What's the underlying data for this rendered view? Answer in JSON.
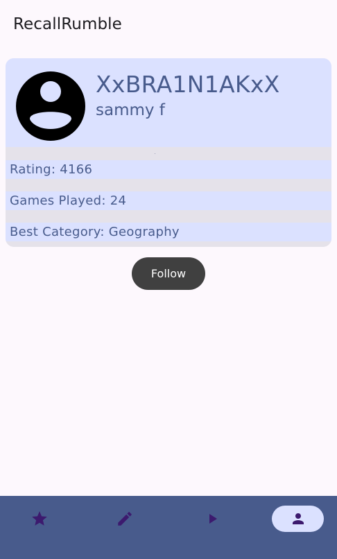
{
  "app": {
    "title": "RecallRumble"
  },
  "profile": {
    "username": "XxBRA1N1AKxX",
    "display_name": "sammy f",
    "avatar_icon": "account-circle-icon",
    "stats": [
      {
        "text": "Rating: 4166"
      },
      {
        "text": "Games Played: 24"
      },
      {
        "text": "Best Category: Geography"
      }
    ]
  },
  "actions": {
    "follow_label": "Follow"
  },
  "bottom_nav": {
    "items": [
      {
        "icon": "star-icon",
        "selected": false
      },
      {
        "icon": "pencil-icon",
        "selected": false
      },
      {
        "icon": "play-icon",
        "selected": false
      },
      {
        "icon": "person-icon",
        "selected": true
      }
    ]
  },
  "colors": {
    "background": "#fdf8fd",
    "card": "#e5e2ea",
    "card_highlight": "#dbe1ff",
    "accent_text": "#485b8c",
    "nav_bar": "#485b8c",
    "nav_icon": "#3c1a6e",
    "button": "#404040"
  }
}
